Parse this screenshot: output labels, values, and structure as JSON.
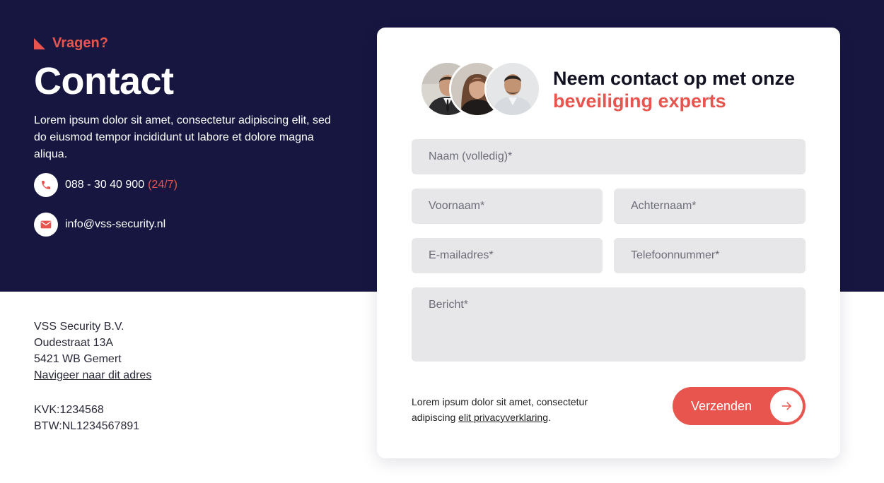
{
  "hero": {
    "eyebrow": "Vragen?",
    "title": "Contact",
    "intro": "Lorem ipsum dolor sit amet, consectetur adipiscing elit, sed do eiusmod tempor incididunt ut labore et dolore magna aliqua.",
    "phone": "088 - 30 40 900",
    "phone_note": "(24/7)",
    "email": "info@vss-security.nl"
  },
  "address": {
    "company": "VSS Security B.V.",
    "street": "Oudestraat 13A",
    "city": "5421 WB Gemert",
    "nav_link": "Navigeer naar dit adres",
    "kvk": "KVK:1234568",
    "btw": "BTW:NL1234567891"
  },
  "form": {
    "heading_line1": "Neem contact op met onze",
    "heading_line2": "beveiliging experts",
    "fields": {
      "full_name": "Naam (volledig)*",
      "first_name": "Voornaam*",
      "last_name": "Achternaam*",
      "email": "E-mailadres*",
      "phone": "Telefoonnummer*",
      "message": "Bericht*"
    },
    "consent_text": "Lorem ipsum dolor sit amet, consectetur adipiscing ",
    "consent_link": "elit privacyverklaring",
    "consent_end": ".",
    "submit_label": "Verzenden"
  },
  "icons": {
    "eyebrow": "corner-triangle-icon",
    "phone": "phone-icon",
    "email": "envelope-icon",
    "submit": "arrow-right-icon",
    "avatars": [
      "avatar-person-1",
      "avatar-person-2",
      "avatar-person-3"
    ]
  },
  "colors": {
    "navy": "#161641",
    "accent": "#e8554f",
    "field_bg": "#e7e7ea",
    "white": "#ffffff"
  }
}
